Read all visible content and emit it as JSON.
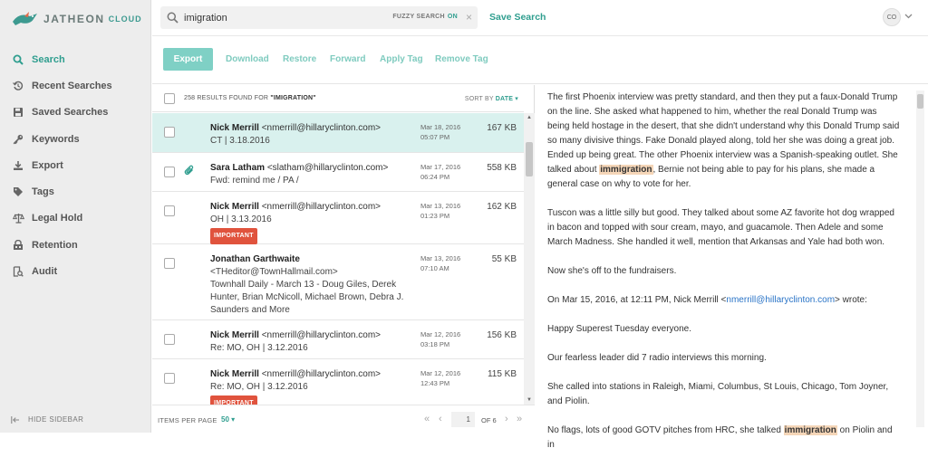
{
  "app": {
    "logo_text": "JATHEON",
    "logo_cloud": "CLOUD",
    "brand_color": "#2f9e8f"
  },
  "sidebar": {
    "items": [
      {
        "label": "Search",
        "icon": "search-icon",
        "active": true
      },
      {
        "label": "Recent Searches",
        "icon": "history-icon",
        "active": false
      },
      {
        "label": "Saved Searches",
        "icon": "floppy-disk-icon",
        "active": false
      },
      {
        "label": "Keywords",
        "icon": "key-icon",
        "active": false
      },
      {
        "label": "Export",
        "icon": "download-icon",
        "active": false
      },
      {
        "label": "Tags",
        "icon": "tag-icon",
        "active": false
      },
      {
        "label": "Legal Hold",
        "icon": "scales-icon",
        "active": false
      },
      {
        "label": "Retention",
        "icon": "retention-icon",
        "active": false
      },
      {
        "label": "Audit",
        "icon": "audit-icon",
        "active": false
      }
    ],
    "hide_label": "HIDE SIDEBAR"
  },
  "search": {
    "value": "imigration",
    "fuzzy_label": "FUZZY SEARCH",
    "fuzzy_state": "ON",
    "clear": "×",
    "save_label": "Save Search"
  },
  "user": {
    "initials": "CO"
  },
  "toolbar": {
    "export": "Export",
    "download": "Download",
    "restore": "Restore",
    "forward": "Forward",
    "apply_tag": "Apply Tag",
    "remove_tag": "Remove Tag"
  },
  "results": {
    "count_prefix": "258 RESULTS FOUND FOR",
    "query": "\"IMIGRATION\"",
    "sort_label": "SORT BY",
    "sort_value": "DATE",
    "rows": [
      {
        "name": "Nick Merrill",
        "email": "<nmerrill@hillaryclinton.com>",
        "subject": "CT | 3.18.2016",
        "date": "Mar 18, 2016",
        "time": "05:07 PM",
        "size": "167 KB",
        "badge": "",
        "attachment": false,
        "selected": true
      },
      {
        "name": "Sara Latham",
        "email": "<slatham@hillaryclinton.com>",
        "subject": "Fwd: remind me / PA /",
        "date": "Mar 17, 2016",
        "time": "06:24 PM",
        "size": "558 KB",
        "badge": "",
        "attachment": true,
        "selected": false
      },
      {
        "name": "Nick Merrill",
        "email": "<nmerrill@hillaryclinton.com>",
        "subject": "OH | 3.13.2016",
        "date": "Mar 13, 2016",
        "time": "01:23 PM",
        "size": "162 KB",
        "badge": "IMPORTANT",
        "attachment": false,
        "selected": false
      },
      {
        "name": "Jonathan Garthwaite",
        "email": "<THeditor@TownHallmail.com>",
        "subject": "Townhall Daily - March 13 - Doug Giles, Derek Hunter, Brian McNicoll, Michael Brown, Debra J. Saunders and More",
        "date": "Mar 13, 2016",
        "time": "07:10 AM",
        "size": "55 KB",
        "badge": "",
        "attachment": false,
        "selected": false
      },
      {
        "name": "Nick Merrill",
        "email": "<nmerrill@hillaryclinton.com>",
        "subject": "Re: MO, OH | 3.12.2016",
        "date": "Mar 12, 2016",
        "time": "03:18 PM",
        "size": "156 KB",
        "badge": "",
        "attachment": false,
        "selected": false
      },
      {
        "name": "Nick Merrill",
        "email": "<nmerrill@hillaryclinton.com>",
        "subject": "Re: MO, OH | 3.12.2016",
        "date": "Mar 12, 2016",
        "time": "12:43 PM",
        "size": "115 KB",
        "badge": "IMPORTANT",
        "attachment": false,
        "selected": false
      }
    ]
  },
  "pager": {
    "items_per_page_label": "ITEMS PER PAGE",
    "items_per_page": "50",
    "current_page": "1",
    "of_label": "OF 6"
  },
  "reader": {
    "p1_a": "The first Phoenix interview was pretty standard, and then they put a faux-Donald Trump on the line.  She asked what happened to him, whether the real Donald Trump was being held hostage in the desert, that she didn't understand why this Donald Trump said so many divisive things.  Fake Donald played along, told her she was doing a great job.  Ended up being great.  The other Phoenix interview was a Spanish-speaking outlet.  She talked about ",
    "p1_hl": "immigration",
    "p1_b": ", Bernie not being able to pay for his plans, she made a general case on why to vote for her.",
    "p2": "Tuscon was a little silly but good.  They talked about some AZ favorite hot dog wrapped in bacon and topped with sour cream, mayo, and guacamole.  Then Adele and some March Madness.  She handled it well, mention that Arkansas and Yale had both won.",
    "p3": "Now she's off to the fundraisers.",
    "p4_a": "On Mar 15, 2016, at 12:11 PM, Nick Merrill <",
    "p4_link": "nmerrill@hillaryclinton.com",
    "p4_b": "> wrote:",
    "p5": "Happy Superest Tuesday everyone.",
    "p6": "Our fearless leader did 7 radio interviews this morning.",
    "p7": "She called into stations in Raleigh, Miami, Columbus, St Louis, Chicago, Tom Joyner, and Piolin.",
    "p8_a": "No flags, lots of good GOTV pitches from HRC, she talked ",
    "p8_hl": "immigration",
    "p8_b": " on Piolin and in"
  }
}
